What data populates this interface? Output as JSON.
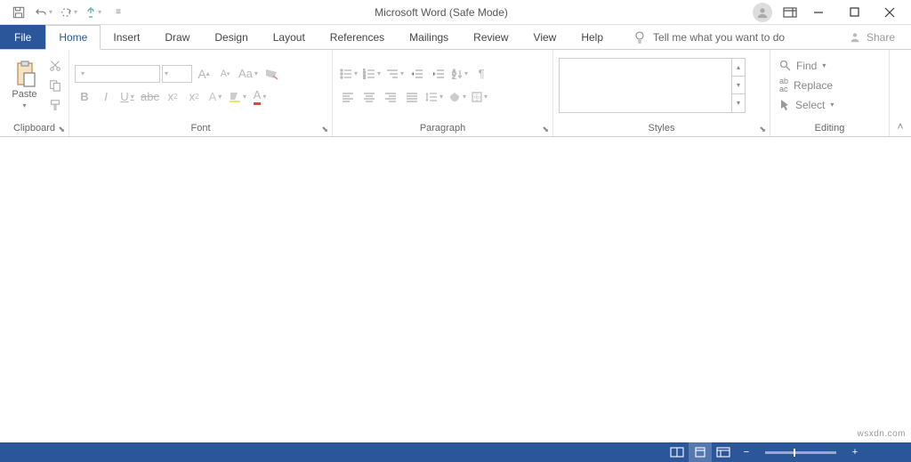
{
  "title": "Microsoft Word (Safe Mode)",
  "tabs": {
    "file": "File",
    "home": "Home",
    "insert": "Insert",
    "draw": "Draw",
    "design": "Design",
    "layout": "Layout",
    "references": "References",
    "mailings": "Mailings",
    "review": "Review",
    "view": "View",
    "help": "Help"
  },
  "tellme": "Tell me what you want to do",
  "share": "Share",
  "groups": {
    "clipboard": "Clipboard",
    "font": "Font",
    "paragraph": "Paragraph",
    "styles": "Styles",
    "editing": "Editing"
  },
  "clipboard": {
    "paste": "Paste"
  },
  "editing": {
    "find": "Find",
    "replace": "Replace",
    "select": "Select"
  },
  "watermark": "wsxdn.com"
}
